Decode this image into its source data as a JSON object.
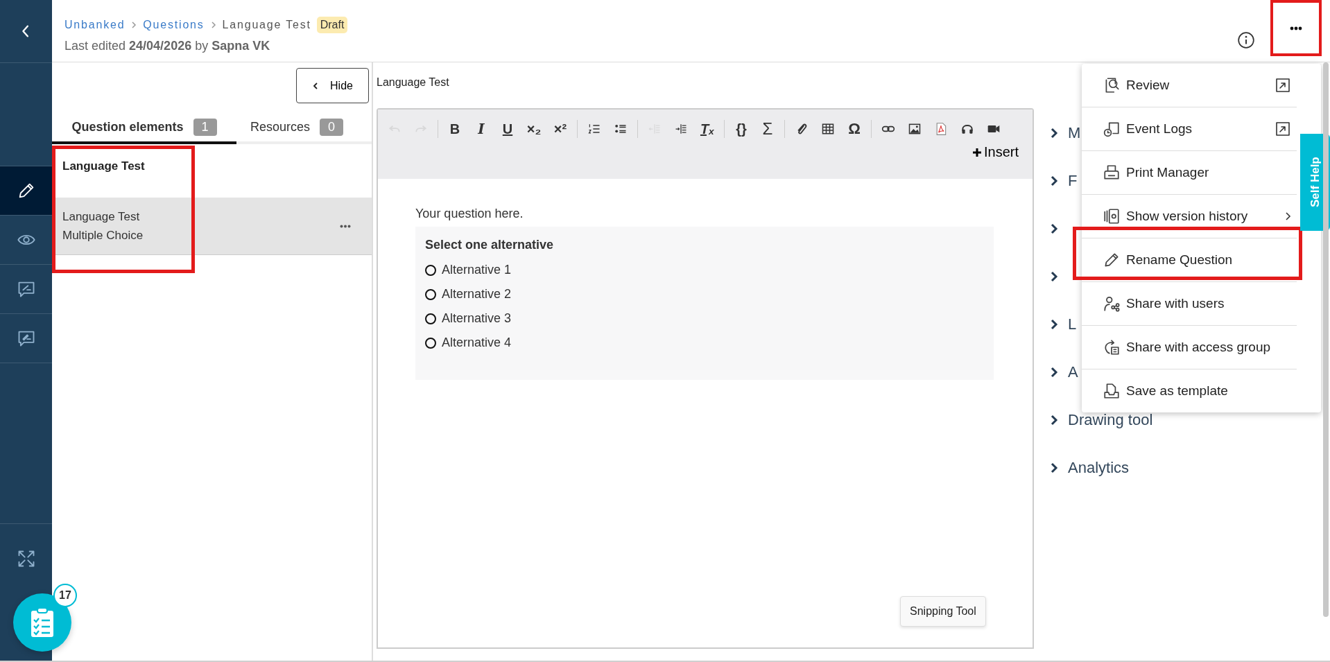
{
  "nav_rail": {
    "back_button": {
      "kind": "back"
    },
    "items": [
      {
        "kind": "edit",
        "selected": true
      },
      {
        "kind": "preview",
        "selected": false
      },
      {
        "kind": "feedback",
        "selected": false
      },
      {
        "kind": "comment",
        "selected": false
      }
    ],
    "bottom_items": [
      {
        "kind": "expand"
      }
    ]
  },
  "header": {
    "breadcrumb": [
      {
        "label": "Unbanked",
        "kind": "link"
      },
      {
        "label": "Questions",
        "kind": "link"
      },
      {
        "label": "Language Test",
        "kind": "current"
      }
    ],
    "status_badge": "Draft",
    "last_edited": "Last edited **24/04/2026** by **Sapna VK**",
    "more_button": {
      "highlighted": true
    }
  },
  "left_panel": {
    "hide_button": "Hide",
    "tabs": [
      {
        "label": "Question elements",
        "count": "1",
        "selected": true
      },
      {
        "label": "Resources",
        "count": "0",
        "selected": false
      }
    ],
    "title": "Language Test",
    "highlighted": true,
    "elements": [
      {
        "title": "Language Test",
        "subtitle": "Multiple Choice",
        "selected": true
      }
    ]
  },
  "editor": {
    "title": "Language Test",
    "toolbar": [
      [
        {
          "kind": "undo",
          "disabled": true
        },
        {
          "kind": "redo",
          "disabled": true
        }
      ],
      [
        {
          "kind": "bold",
          "glyph": "B",
          "disabled": false
        },
        {
          "kind": "italic",
          "glyph": "I",
          "disabled": false
        },
        {
          "kind": "underline",
          "glyph": "U",
          "disabled": false
        },
        {
          "kind": "subscript",
          "glyph": "×₂",
          "disabled": false
        },
        {
          "kind": "superscript",
          "glyph": "×²",
          "disabled": false
        }
      ],
      [
        {
          "kind": "numbered-list",
          "disabled": false
        },
        {
          "kind": "bulleted-list",
          "disabled": false
        }
      ],
      [
        {
          "kind": "outdent",
          "disabled": true
        },
        {
          "kind": "indent",
          "disabled": false
        },
        {
          "kind": "clear-format",
          "glyph": "Tₓ",
          "disabled": false
        }
      ],
      [
        {
          "kind": "braces",
          "glyph": "{}",
          "disabled": false
        },
        {
          "kind": "sigma",
          "glyph": "Σ",
          "disabled": false
        }
      ],
      [
        {
          "kind": "attach",
          "disabled": false
        },
        {
          "kind": "table",
          "disabled": false
        },
        {
          "kind": "omega",
          "glyph": "Ω",
          "disabled": false
        }
      ],
      [
        {
          "kind": "link",
          "disabled": false
        },
        {
          "kind": "image",
          "disabled": false
        },
        {
          "kind": "pdf",
          "disabled": false
        },
        {
          "kind": "audio",
          "disabled": false
        },
        {
          "kind": "video",
          "disabled": false
        }
      ]
    ],
    "insert_button": "Insert",
    "prompt": "Your question here.",
    "instruction": "Select one alternative",
    "alternatives": [
      {
        "label": "Alternative 1",
        "selected": false
      },
      {
        "label": "Alternative 2",
        "selected": false
      },
      {
        "label": "Alternative 3",
        "selected": false
      },
      {
        "label": "Alternative 4",
        "selected": false
      }
    ]
  },
  "right_panel": {
    "sections": [
      {
        "label": "M",
        "expanded": false
      },
      {
        "label": "F",
        "expanded": false
      },
      {
        "expanded": false
      },
      {
        "expanded": false
      },
      {
        "label": "L",
        "expanded": false
      },
      {
        "label": "A",
        "expanded": false
      },
      {
        "label": "Drawing tool",
        "expanded": false
      },
      {
        "label": "Analytics",
        "expanded": false
      }
    ]
  },
  "more_menu": {
    "items": [
      {
        "kind": "review",
        "label": "Review",
        "external": true,
        "submenu": false,
        "highlighted": false
      },
      {
        "kind": "event-logs",
        "label": "Event Logs",
        "external": true,
        "submenu": false,
        "highlighted": false
      },
      {
        "kind": "print",
        "label": "Print Manager",
        "external": false,
        "submenu": false,
        "highlighted": false
      },
      {
        "kind": "versions",
        "label": "Show version history",
        "external": false,
        "submenu": true,
        "highlighted": false
      },
      {
        "kind": "rename",
        "label": "Rename Question",
        "external": false,
        "submenu": false,
        "highlighted": true
      },
      {
        "kind": "share-users",
        "label": "Share with users",
        "external": false,
        "submenu": false,
        "highlighted": false
      },
      {
        "kind": "share-group",
        "label": "Share with access group",
        "external": false,
        "submenu": false,
        "highlighted": false
      },
      {
        "kind": "template",
        "label": "Save as template",
        "external": false,
        "submenu": false,
        "highlighted": false
      }
    ]
  },
  "self_help_tab": "Self Help",
  "tasks_button": {
    "count": "17"
  },
  "tooltip": "Snipping Tool"
}
